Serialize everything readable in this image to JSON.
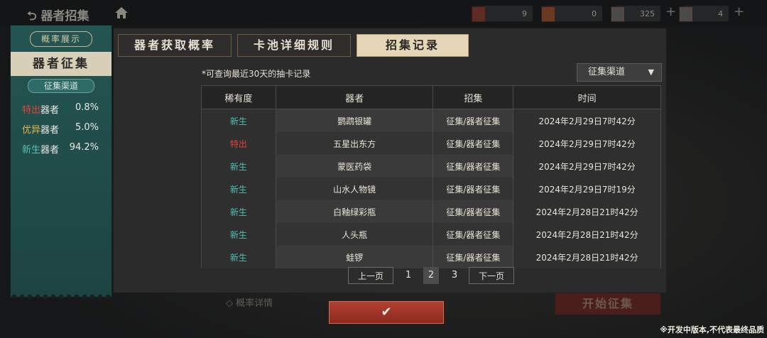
{
  "header": {
    "back_label": "器者招集",
    "resources": [
      {
        "icon": "red-ticket-icon",
        "value": "9"
      },
      {
        "icon": "wine-jar-icon",
        "value": "0"
      },
      {
        "icon": "coin-icon",
        "value": "325"
      },
      {
        "icon": "gem-icon",
        "value": "4"
      }
    ]
  },
  "left_panel": {
    "tag": "概率展示",
    "title": "器者征集",
    "channel": "征集渠道",
    "rates": [
      {
        "rarity": "特出",
        "suffix": "器者",
        "percent": "0.8%",
        "color": "#e0453d"
      },
      {
        "rarity": "优异",
        "suffix": "器者",
        "percent": "5.0%",
        "color": "#e6b84a"
      },
      {
        "rarity": "新生",
        "suffix": "器者",
        "percent": "94.2%",
        "color": "#53c2b5"
      }
    ]
  },
  "tabs": [
    {
      "label": "器者获取概率"
    },
    {
      "label": "卡池详细规则"
    },
    {
      "label": "招集记录"
    }
  ],
  "note": "*可查询最近30天的抽卡记录",
  "filter": {
    "selected": "征集渠道"
  },
  "table": {
    "headers": [
      "稀有度",
      "器者",
      "招集",
      "时间"
    ],
    "rows": [
      {
        "rarity": "新生",
        "rarity_color": "#4fbfb3",
        "item": "鹦鹉银罐",
        "source": "征集/器者征集",
        "time": "2024年2月29日7时42分"
      },
      {
        "rarity": "特出",
        "rarity_color": "#e0453d",
        "item": "五星出东方",
        "source": "征集/器者征集",
        "time": "2024年2月29日7时42分"
      },
      {
        "rarity": "新生",
        "rarity_color": "#4fbfb3",
        "item": "蒙医药袋",
        "source": "征集/器者征集",
        "time": "2024年2月29日7时42分"
      },
      {
        "rarity": "新生",
        "rarity_color": "#4fbfb3",
        "item": "山水人物镜",
        "source": "征集/器者征集",
        "time": "2024年2月29日7时19分"
      },
      {
        "rarity": "新生",
        "rarity_color": "#4fbfb3",
        "item": "白釉绿彩瓶",
        "source": "征集/器者征集",
        "time": "2024年2月28日21时42分"
      },
      {
        "rarity": "新生",
        "rarity_color": "#4fbfb3",
        "item": "人头瓶",
        "source": "征集/器者征集",
        "time": "2024年2月28日21时42分"
      },
      {
        "rarity": "新生",
        "rarity_color": "#4fbfb3",
        "item": "蛙锣",
        "source": "征集/器者征集",
        "time": "2024年2月28日21时42分"
      }
    ]
  },
  "pager": {
    "prev": "上一页",
    "next": "下一页",
    "pages": [
      "1",
      "2",
      "3"
    ],
    "current": "2"
  },
  "footer": {
    "rate_details": "概率详情",
    "start": "开始征集",
    "disclaimer": "※开发中版本,不代表最终品质"
  }
}
